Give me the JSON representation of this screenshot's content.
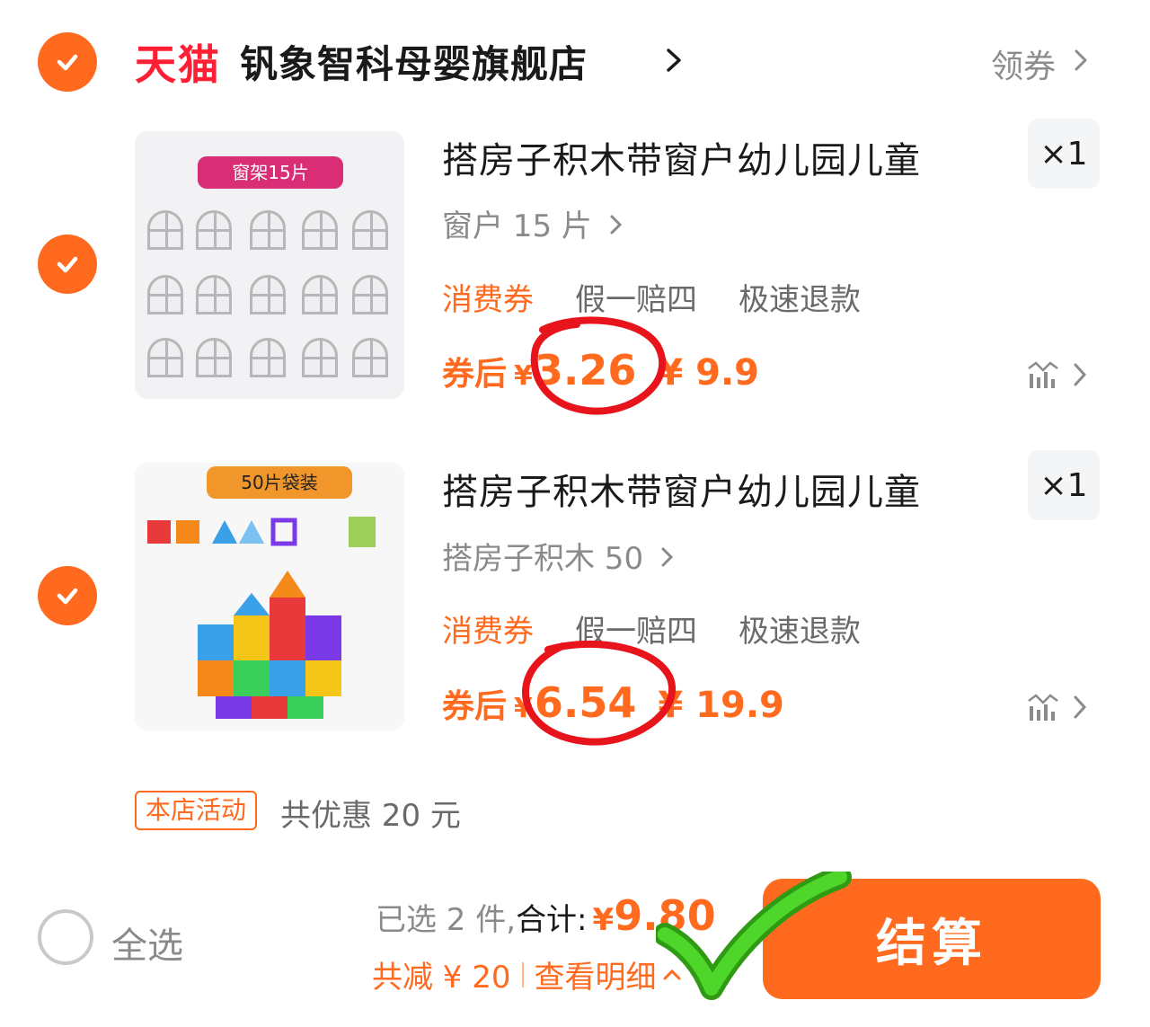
{
  "shop": {
    "brand": "天猫",
    "name": "钒象智科母婴旗舰店",
    "coupon_label": "领券"
  },
  "products": [
    {
      "image_tag": "窗架15片",
      "title": "搭房子积木带窗户幼儿园儿童",
      "variant": "窗户 15 片",
      "badges": [
        "消费券",
        "假一赔四",
        "极速退款"
      ],
      "after_coupon_label": "券后",
      "after_coupon_price": "3.26",
      "original_price": "¥ 9.9",
      "quantity": "×1"
    },
    {
      "image_tag": "50片袋装",
      "title": "搭房子积木带窗户幼儿园儿童",
      "variant": "搭房子积木 50",
      "badges": [
        "消费券",
        "假一赔四",
        "极速退款"
      ],
      "after_coupon_label": "券后",
      "after_coupon_price": "6.54",
      "original_price": "¥ 19.9",
      "quantity": "×1"
    }
  ],
  "promotion": {
    "tag": "本店活动",
    "text": "共优惠 20 元"
  },
  "footer": {
    "select_all": "全选",
    "selected_count": "已选 2 件,",
    "total_label": "合计:",
    "currency": "¥",
    "total": "9.80",
    "discount": "共减 ¥ 20",
    "details": "查看明细",
    "checkout": "结算"
  },
  "colors": {
    "accent": "#ff6a1f",
    "tmall": "#ff1f35",
    "annotation_red": "#e8141b",
    "annotation_green": "#3cc21a"
  }
}
